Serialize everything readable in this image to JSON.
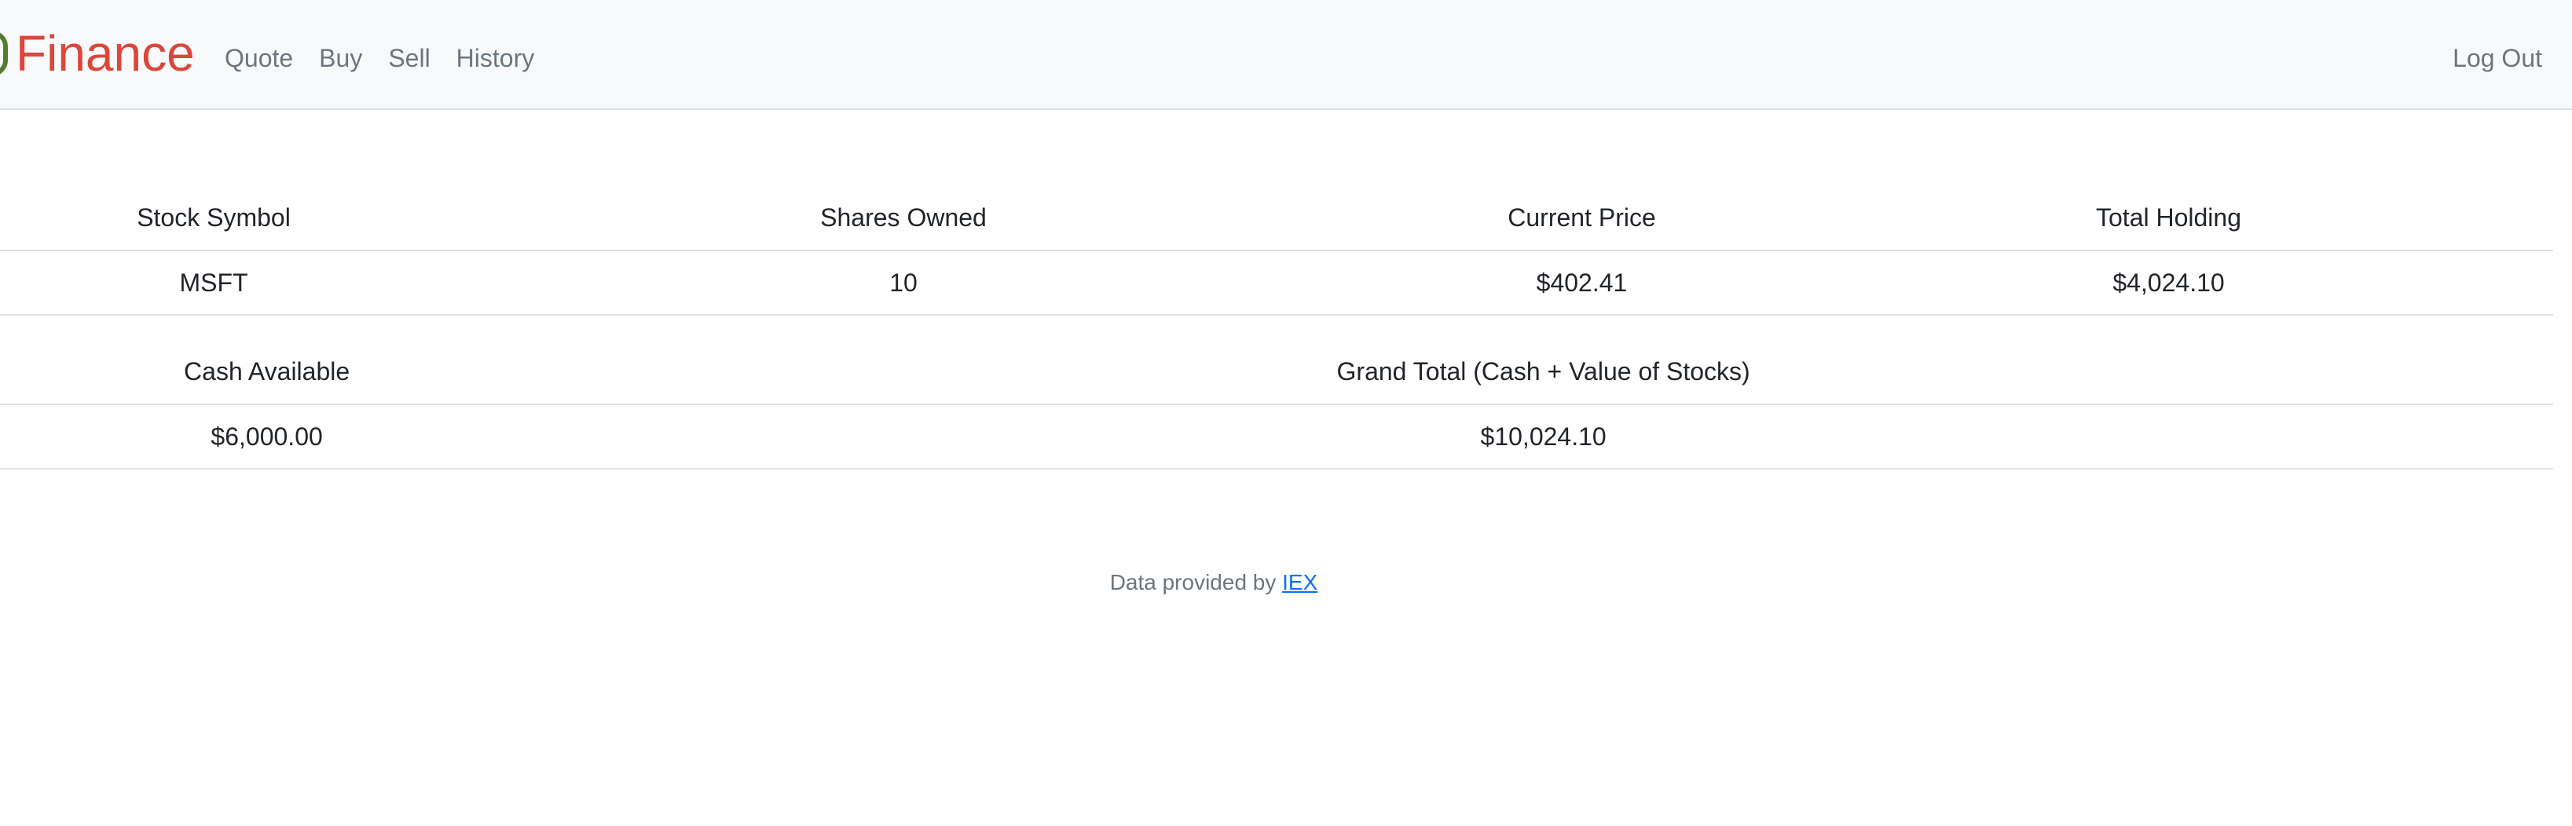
{
  "navbar": {
    "brand": "Finance",
    "links": [
      "Quote",
      "Buy",
      "Sell",
      "History"
    ],
    "logout": "Log Out",
    "brand_color": "#d9483b",
    "link_color": "#6c757d"
  },
  "holdings": {
    "headers": [
      "Stock Symbol",
      "Shares Owned",
      "Current Price",
      "Total Holding"
    ],
    "rows": [
      [
        "MSFT",
        "10",
        "$402.41",
        "$4,024.10"
      ]
    ]
  },
  "totals": {
    "headers": [
      "Cash Available",
      "Grand Total (Cash + Value of Stocks)"
    ],
    "rows": [
      [
        "$6,000.00",
        "$10,024.10"
      ]
    ]
  },
  "footer": {
    "text": "Data provided by ",
    "link": "IEX",
    "link_color": "#0d6efd"
  }
}
